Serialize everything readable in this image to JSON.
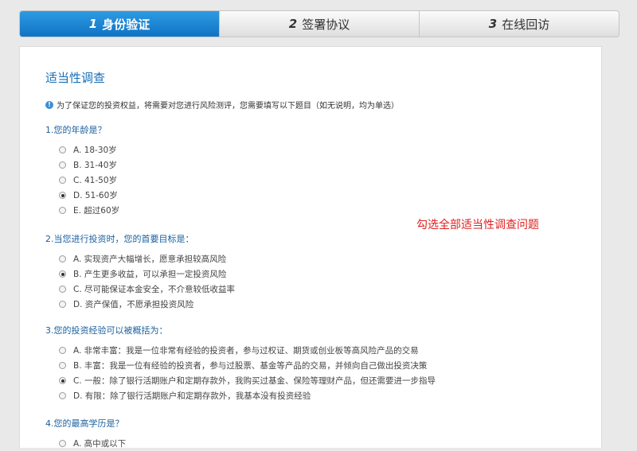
{
  "steps": [
    {
      "num": "1",
      "label": "身份验证",
      "active": true
    },
    {
      "num": "2",
      "label": "签署协议",
      "active": false
    },
    {
      "num": "3",
      "label": "在线回访",
      "active": false
    }
  ],
  "title": "适当性调查",
  "notice": "为了保证您的投资权益，将需要对您进行风险测评，您需要填写以下题目（如无说明，均为单选）",
  "annotation": "勾选全部适当性调查问题",
  "questions": [
    {
      "text": "1.您的年龄是？",
      "options": [
        "A. 18-30岁",
        "B. 31-40岁",
        "C. 41-50岁",
        "D. 51-60岁",
        "E. 超过60岁"
      ],
      "selected": 3
    },
    {
      "text": "2.当您进行投资时，您的首要目标是：",
      "options": [
        "A. 实现资产大幅增长，愿意承担较高风险",
        "B. 产生更多收益，可以承担一定投资风险",
        "C. 尽可能保证本金安全，不介意较低收益率",
        "D. 资产保值，不愿承担投资风险"
      ],
      "selected": 1
    },
    {
      "text": "3.您的投资经验可以被概括为：",
      "options": [
        "A. 非常丰富：我是一位非常有经验的投资者，参与过权证、期货或创业板等高风险产品的交易",
        "B. 丰富：我是一位有经验的投资者，参与过股票、基金等产品的交易，并倾向自己做出投资决策",
        "C. 一般：除了银行活期账户和定期存款外，我购买过基金、保险等理财产品，但还需要进一步指导",
        "D. 有限：除了银行活期账户和定期存款外，我基本没有投资经验"
      ],
      "selected": 2
    },
    {
      "text": "4.您的最高学历是？",
      "options": [
        "A. 高中或以下"
      ],
      "selected": -1
    }
  ]
}
